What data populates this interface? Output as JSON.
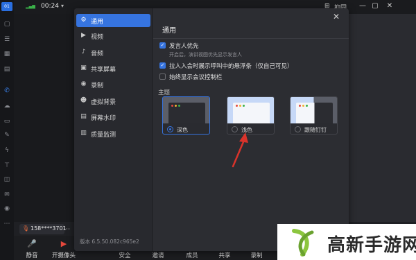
{
  "app_rail": {
    "logo_text": "01"
  },
  "titlebar": {
    "time": "00:24",
    "right_text": "抑同"
  },
  "nametag": {
    "name": "158****3701"
  },
  "bottom_bar": {
    "buttons": [
      {
        "label": "静音"
      },
      {
        "label": "开摄像头"
      },
      {
        "label": "安全"
      },
      {
        "label": "邀请"
      },
      {
        "label": "成员"
      },
      {
        "label": "共享"
      },
      {
        "label": "录制"
      }
    ]
  },
  "settings": {
    "nav": [
      {
        "label": "通用",
        "icon": "gear-icon",
        "active": true
      },
      {
        "label": "视频",
        "icon": "video-icon"
      },
      {
        "label": "音频",
        "icon": "mic-icon"
      },
      {
        "label": "共享屏幕",
        "icon": "share-screen-icon"
      },
      {
        "label": "录制",
        "icon": "record-icon"
      },
      {
        "label": "虚拟背景",
        "icon": "virtual-background-icon"
      },
      {
        "label": "屏幕水印",
        "icon": "watermark-icon"
      },
      {
        "label": "质量监测",
        "icon": "quality-icon"
      }
    ],
    "version": "版本 6.5.50.082c965e2",
    "title": "通用",
    "options": [
      {
        "label": "发言人优先",
        "checked": true,
        "sub": "开启后，演讲视图优先显示发言人"
      },
      {
        "label": "拉人入会时展示呼叫中的悬浮条（仅自己可见）",
        "checked": true
      },
      {
        "label": "始终显示会议控制栏",
        "checked": false
      }
    ],
    "theme_section": "主题",
    "themes": [
      {
        "label": "深色",
        "selected": true
      },
      {
        "label": "浅色",
        "selected": false
      },
      {
        "label": "跟随钉钉",
        "selected": false
      }
    ],
    "accent": "#3674e0"
  },
  "watermark": {
    "text": "高新手游网",
    "color": "#2a2a2a",
    "logo_color": "#8cc63f"
  }
}
